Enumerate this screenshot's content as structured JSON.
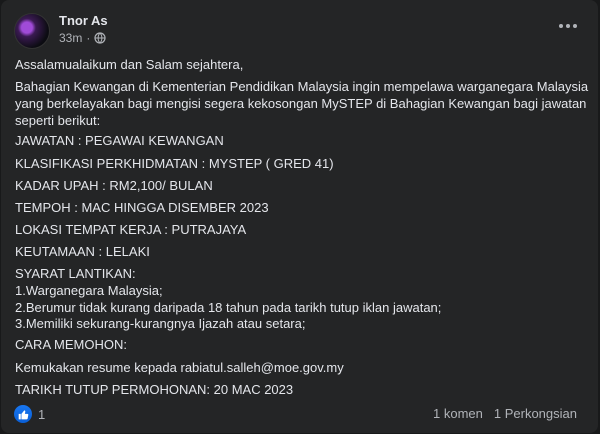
{
  "post": {
    "author": "Tnor As",
    "time": "33m",
    "dot": "·",
    "audience_icon": "globe-icon",
    "more_icon": "more-options-icon",
    "lines": [
      "Assalamualaikum dan Salam sejahtera,",
      "Bahagian Kewangan di Kementerian Pendidikan Malaysia ingin mempelawa warganegara Malaysia",
      "yang berkelayakan bagi mengisi segera kekosongan MySTEP di Bahagian Kewangan bagi jawatan",
      "seperti berikut:",
      "JAWATAN : PEGAWAI KEWANGAN",
      "KLASIFIKASI PERKHIDMATAN : MYSTEP ( GRED 41)",
      "KADAR UPAH : RM2,100/ BULAN",
      "TEMPOH : MAC HINGGA DISEMBER 2023",
      "LOKASI TEMPAT KERJA : PUTRAJAYA",
      "KEUTAMAAN : LELAKI",
      "SYARAT LANTIKAN:",
      "1.Warganegara Malaysia;",
      "2.Berumur tidak kurang daripada 18 tahun pada tarikh tutup iklan jawatan;",
      "3.Memiliki sekurang-kurangnya Ijazah atau setara;",
      "CARA MEMOHON:",
      "Kemukakan resume kepada rabiatul.salleh@moe.gov.my",
      "TARIKH TUTUP PERMOHONAN: 20 MAC 2023"
    ]
  },
  "reactions": {
    "icon": "like-icon",
    "count": "1",
    "color": "#1877f2"
  },
  "stats": {
    "comments": "1 komen",
    "shares": "1 Perkongsian"
  }
}
